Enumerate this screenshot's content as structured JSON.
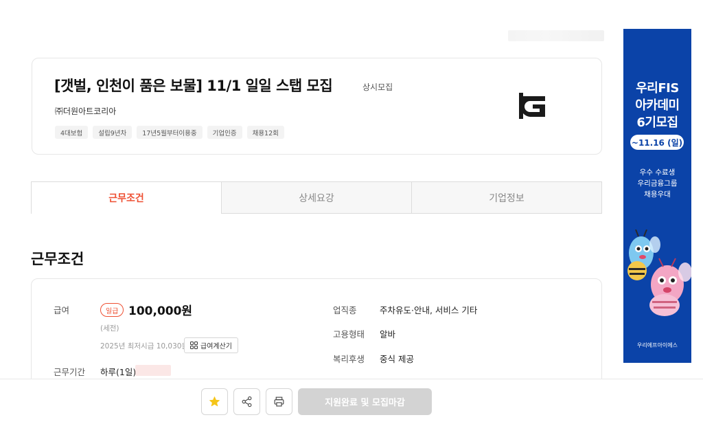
{
  "job": {
    "title": "[갯벌, 인천이 품은 보물] 11/1 일일 스탭 모집",
    "recruit_type": "상시모집",
    "company": "㈜더원아트코리아",
    "badges": [
      "4대보험",
      "설립9년차",
      "17년5월부터이용중",
      "기업인증",
      "채용12회"
    ]
  },
  "tabs": [
    {
      "label": "근무조건",
      "active": true
    },
    {
      "label": "상세요강",
      "active": false
    },
    {
      "label": "기업정보",
      "active": false
    }
  ],
  "conditions": {
    "section_title": "근무조건",
    "pay_label": "급여",
    "pay_type": "일급",
    "pay_amount": "100,000원",
    "pay_note": "(세전)",
    "min_wage": "2025년 최저시급 10,030원",
    "calc_button": "급여계산기",
    "period_label": "근무기간",
    "period_value": "하루(1일)",
    "industry_label": "업직종",
    "industry_value": "주차유도·안내, 서비스 기타",
    "employment_label": "고용형태",
    "employment_value": "알바",
    "benefits_label": "복리후생",
    "benefits_value": "중식 제공"
  },
  "ad": {
    "line1": "우리FIS",
    "line2": "아카데미",
    "line3": "6기모집",
    "date": "~11.16 (일)",
    "sub1": "우수 수료생",
    "sub2": "우리금융그룹",
    "sub3": "채용우대",
    "logo_text": "우리에프아이에스",
    "bg_color": "#0b43a8"
  },
  "bottom": {
    "apply_button": "지원완료 및 모집마감",
    "icons": [
      "star-icon",
      "share-icon",
      "print-icon"
    ]
  },
  "colors": {
    "accent": "#ee4f32",
    "star": "#f5c518"
  }
}
